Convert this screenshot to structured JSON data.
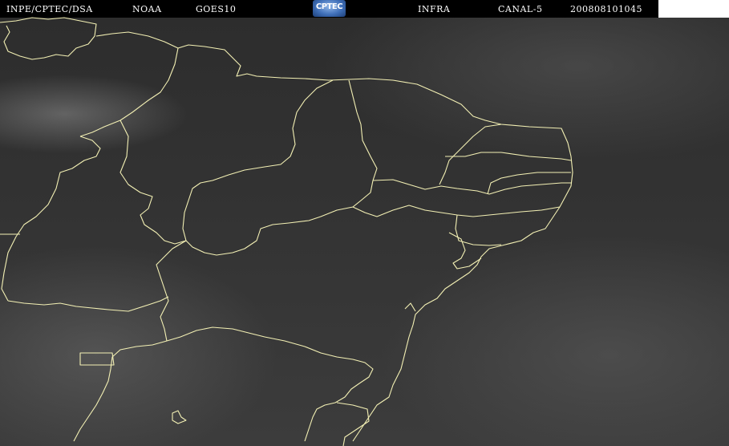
{
  "header": {
    "source": "INPE/CPTEC/DSA",
    "agency": "NOAA",
    "satellite": "GOES10",
    "logo_text": "CPTEC",
    "image_type": "INFRA",
    "channel": "CANAL-5",
    "timestamp": "200808101045"
  },
  "colors": {
    "border_line": "#f3f0b4",
    "header_bg": "#000000",
    "header_text": "#ffffff"
  },
  "map": {
    "region": "Northeast Brazil",
    "lines": "state and coastal borders"
  }
}
